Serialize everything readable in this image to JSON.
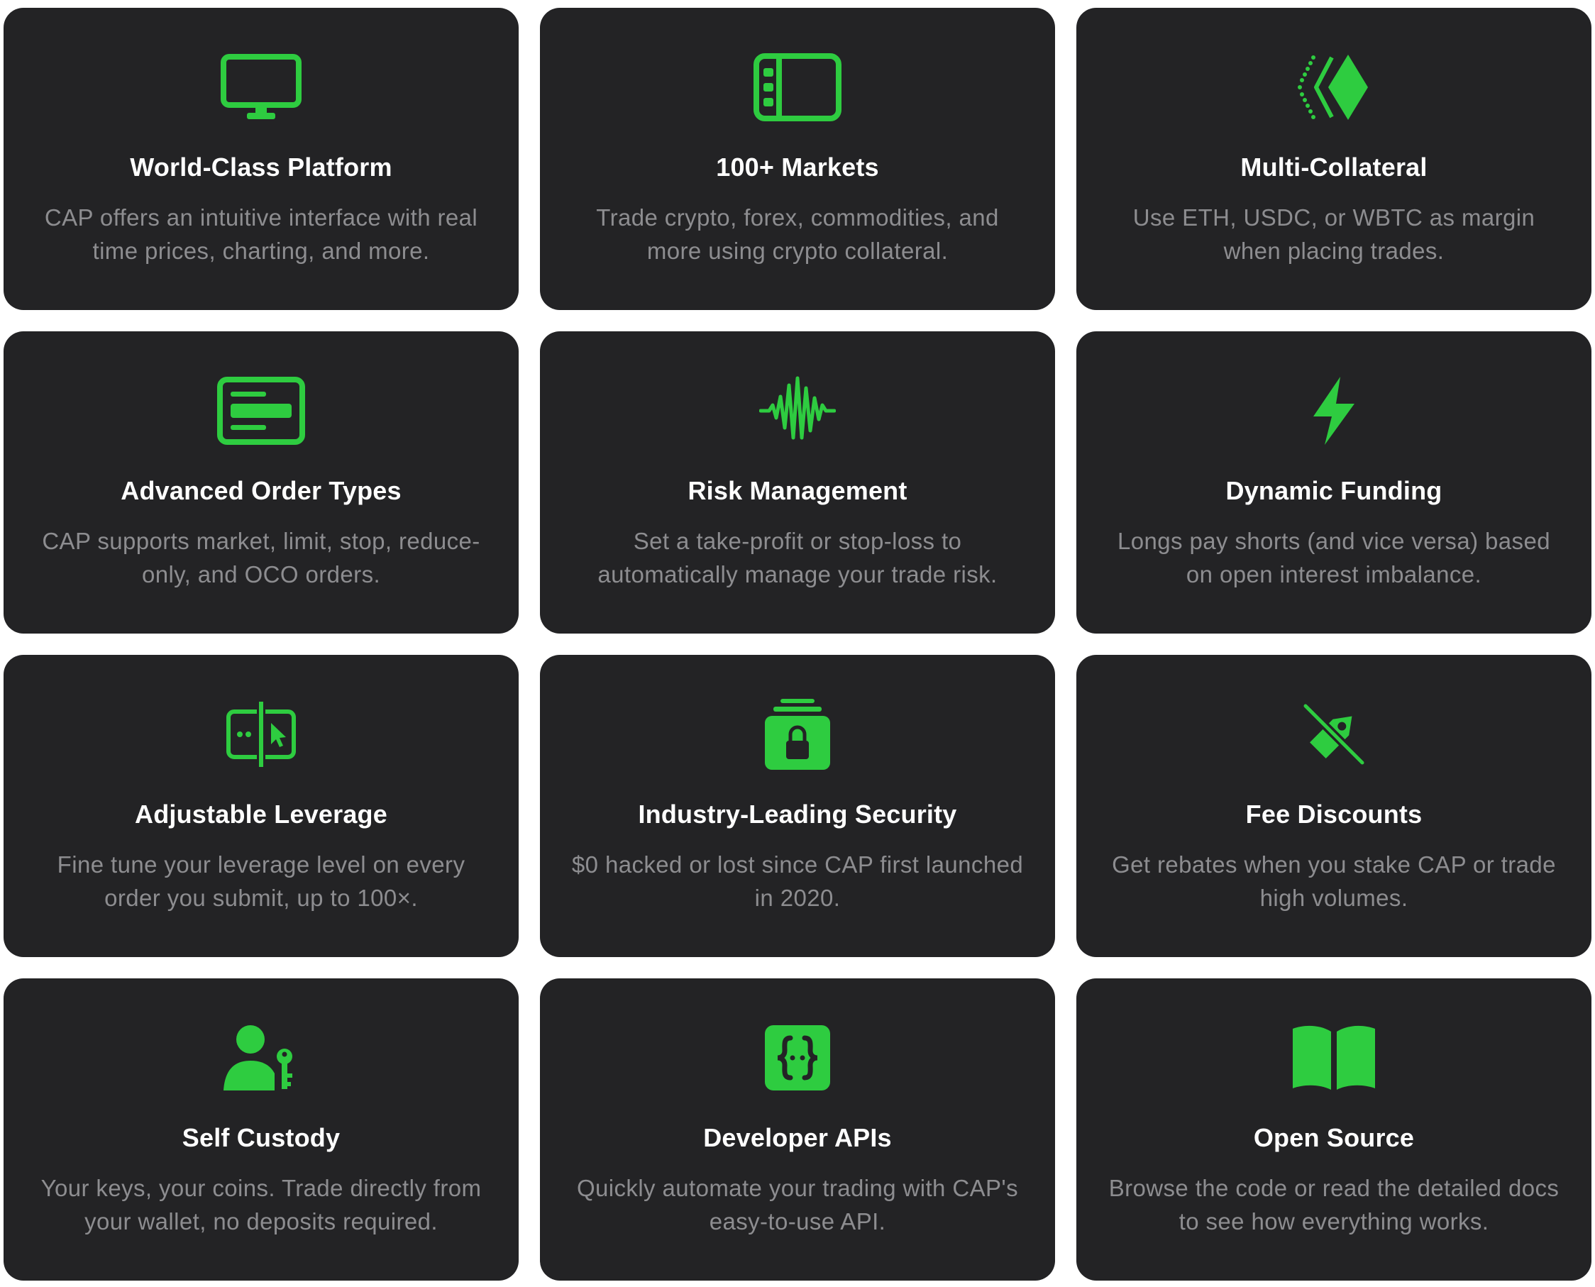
{
  "theme": {
    "card_bg": "#232325",
    "accent": "#2ecc40",
    "title_color": "#ffffff",
    "desc_color": "#8d8d90"
  },
  "features": [
    {
      "icon": "monitor-icon",
      "title": "World-Class Platform",
      "description": "CAP offers an intuitive interface with real time prices, charting, and more."
    },
    {
      "icon": "sidebar-layout-icon",
      "title": "100+ Markets",
      "description": "Trade crypto, forex, commodities, and more using crypto collateral."
    },
    {
      "icon": "diamond-chevron-icon",
      "title": "Multi-Collateral",
      "description": "Use ETH, USDC, or WBTC as margin when placing trades."
    },
    {
      "icon": "order-card-icon",
      "title": "Advanced Order Types",
      "description": "CAP supports market, limit, stop, reduce-only, and OCO orders."
    },
    {
      "icon": "waveform-icon",
      "title": "Risk Management",
      "description": "Set a take-profit or stop-loss to automatically manage your trade risk."
    },
    {
      "icon": "lightning-bolt-icon",
      "title": "Dynamic Funding",
      "description": "Longs pay shorts (and vice versa) based on open interest imbalance."
    },
    {
      "icon": "split-cursor-icon",
      "title": "Adjustable Leverage",
      "description": "Fine tune your leverage level on every order you submit, up to 100×."
    },
    {
      "icon": "lock-stack-icon",
      "title": "Industry-Leading Security",
      "description": "$0 hacked or lost since CAP first launched in 2020."
    },
    {
      "icon": "tag-slash-icon",
      "title": "Fee Discounts",
      "description": "Get rebates when you stake CAP or trade high volumes."
    },
    {
      "icon": "person-key-icon",
      "title": "Self Custody",
      "description": "Your keys, your coins. Trade directly from your wallet, no deposits required."
    },
    {
      "icon": "curly-braces-icon",
      "title": "Developer APIs",
      "description": "Quickly automate your trading with CAP's easy-to-use API."
    },
    {
      "icon": "open-book-icon",
      "title": "Open Source",
      "description": "Browse the code or read the detailed docs to see how everything works."
    }
  ]
}
